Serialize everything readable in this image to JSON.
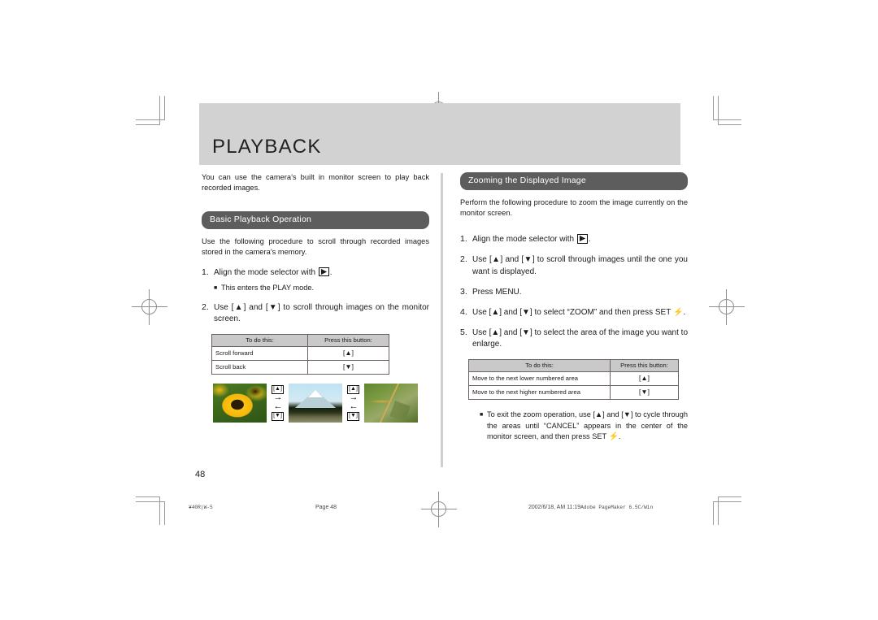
{
  "document": {
    "chapter_title": "PLAYBACK",
    "page_number": "48"
  },
  "left_column": {
    "intro": "You can use the camera’s built in monitor screen to play back recorded images.",
    "section_title": "Basic Playback Operation",
    "section_intro": "Use the following procedure to scroll through recorded images stored in the camera’s memory.",
    "steps": [
      {
        "num": "1.",
        "text_before": "Align the mode selector with ",
        "icon": "play-mode-icon",
        "text_after": "."
      },
      {
        "num": "2.",
        "text": "Use [▲] and [▼] to scroll through images on the monitor screen."
      }
    ],
    "bullet_1": "This enters the PLAY mode.",
    "table": {
      "headers": [
        "To do this:",
        "Press this button:"
      ],
      "rows": [
        [
          "Scroll forward",
          "[▲]"
        ],
        [
          "Scroll back",
          "[▼]"
        ]
      ]
    },
    "photo_strip": {
      "photos": [
        "flower-photo",
        "mountain-photo",
        "dragonfly-photo"
      ],
      "arrow_groups": [
        {
          "up_key": "[▲]",
          "right_arrow": "→",
          "left_arrow": "←",
          "down_key": "[▼]"
        },
        {
          "up_key": "[▲]",
          "right_arrow": "→",
          "left_arrow": "←",
          "down_key": "[▼]"
        }
      ]
    }
  },
  "right_column": {
    "section_title": "Zooming the Displayed Image",
    "section_intro": "Perform the following procedure to zoom the image currently on the monitor screen.",
    "steps": [
      {
        "num": "1.",
        "text_before": "Align the mode selector with ",
        "icon": "play-mode-icon",
        "text_after": "."
      },
      {
        "num": "2.",
        "text": "Use [▲] and [▼] to scroll through images until the one you want is displayed."
      },
      {
        "num": "3.",
        "text": "Press MENU."
      },
      {
        "num": "4.",
        "text_before": "Use [▲] and [▼] to select “ZOOM” and then press SET ",
        "icon": "flash-bolt-icon",
        "text_after": "."
      },
      {
        "num": "5.",
        "text": "Use [▲] and [▼] to select the area of the image you want to enlarge."
      }
    ],
    "table": {
      "headers": [
        "To do this:",
        "Press this button:"
      ],
      "rows": [
        [
          "Move to the next lower numbered area",
          "[▲]"
        ],
        [
          "Move to the next higher numbered area",
          "[▼]"
        ]
      ]
    },
    "bullet_exit": {
      "text_before": "To exit the zoom operation, use [▲] and [▼] to cycle through the areas until “CANCEL” appears in the center of the monitor screen, and then press SET ",
      "icon": "flash-bolt-icon",
      "text_after": "."
    }
  },
  "footer": {
    "left": "¥40R|W-5",
    "center": "Page 48",
    "right_sans": "2002/6/18, AM 11:19",
    "right_mono": "Adobe PageMaker 6.5C/Win"
  },
  "colors": {
    "banner_gray": "#d2d2d2",
    "section_bar_gray": "#5d5d5d",
    "table_header_gray": "#c9c9c9",
    "divider_gray": "#cfcfcf",
    "crop_mark_gray": "#9a9a9a"
  }
}
